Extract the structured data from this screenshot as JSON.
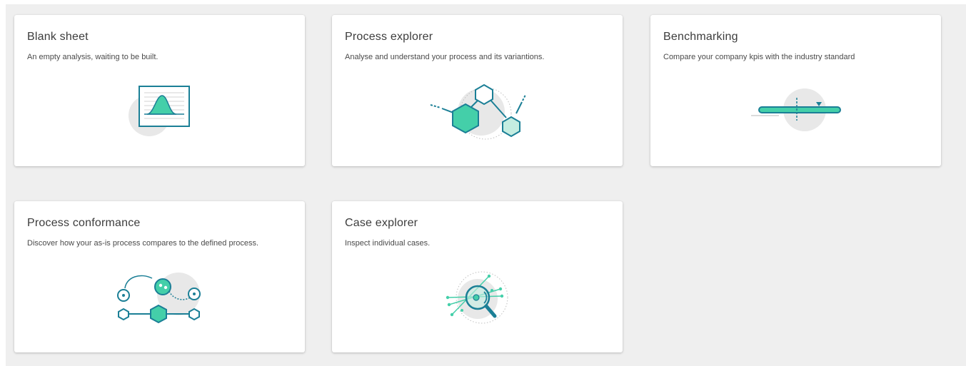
{
  "cards": [
    {
      "title": "Blank sheet",
      "description": "An empty analysis, waiting to be built.",
      "icon": "blank-sheet-icon"
    },
    {
      "title": "Process explorer",
      "description": "Analyse and understand your process and its variantions.",
      "icon": "process-explorer-icon"
    },
    {
      "title": "Benchmarking",
      "description": "Compare your company kpis with the industry standard",
      "icon": "benchmarking-icon"
    },
    {
      "title": "Process conformance",
      "description": "Discover how your as-is process compares to the defined process.",
      "icon": "process-conformance-icon"
    },
    {
      "title": "Case explorer",
      "description": "Inspect individual cases.",
      "icon": "case-explorer-icon"
    }
  ],
  "colors": {
    "accent": "#44cfa9",
    "accent_light": "#c4ede1",
    "outline": "#1b7f96",
    "disc": "#e8e8e8",
    "background": "#efefef"
  }
}
